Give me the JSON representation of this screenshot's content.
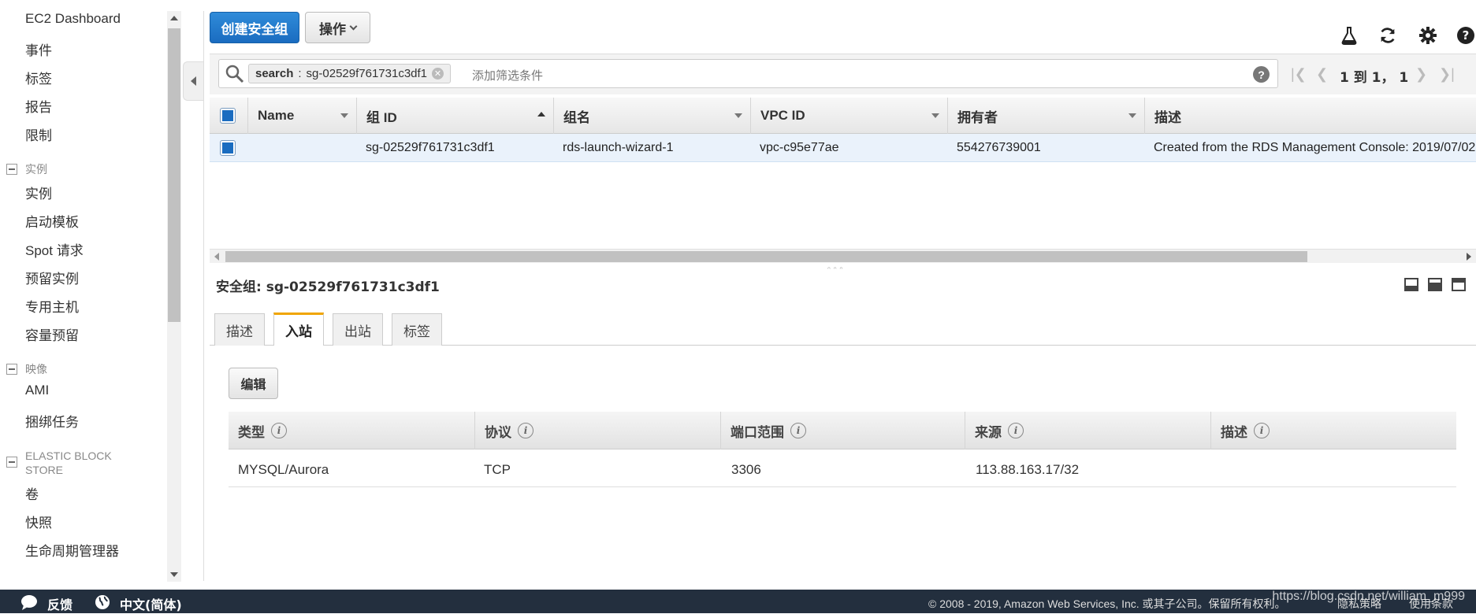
{
  "sidebar": {
    "items_top": [
      "EC2 Dashboard",
      "事件",
      "标签",
      "报告",
      "限制"
    ],
    "sections": [
      {
        "title": "实例",
        "items": [
          "实例",
          "启动模板",
          "Spot 请求",
          "预留实例",
          "专用主机",
          "容量预留"
        ]
      },
      {
        "title": "映像",
        "items": [
          "AMI",
          "捆绑任务"
        ]
      },
      {
        "title": "ELASTIC BLOCK STORE",
        "items": [
          "卷",
          "快照",
          "生命周期管理器"
        ]
      }
    ]
  },
  "toolbar": {
    "create_label": "创建安全组",
    "actions_label": "操作"
  },
  "search": {
    "token_key": "search",
    "token_value": "sg-02529f761731c3df1",
    "placeholder": "添加筛选条件",
    "help": "?"
  },
  "pager": {
    "text": "1 到 1， 1"
  },
  "grid": {
    "columns": [
      "Name",
      "组 ID",
      "组名",
      "VPC ID",
      "拥有者",
      "描述"
    ],
    "row": {
      "name": "",
      "group_id": "sg-02529f761731c3df1",
      "group_name": "rds-launch-wizard-1",
      "vpc_id": "vpc-c95e77ae",
      "owner": "554276739001",
      "description": "Created from the RDS Management Console: 2019/07/02"
    }
  },
  "detail": {
    "title": "安全组: sg-02529f761731c3df1",
    "tabs": [
      "描述",
      "入站",
      "出站",
      "标签"
    ],
    "active_tab": "入站",
    "edit_label": "编辑",
    "rules_columns": [
      "类型",
      "协议",
      "端口范围",
      "来源",
      "描述"
    ],
    "rules": [
      {
        "type": "MYSQL/Aurora",
        "protocol": "TCP",
        "port": "3306",
        "source": "113.88.163.17/32",
        "description": ""
      }
    ]
  },
  "footer": {
    "feedback": "反馈",
    "language": "中文(简体)",
    "copyright": "© 2008 - 2019, Amazon Web Services, Inc. 或其子公司。保留所有权利。",
    "privacy": "隐私策略",
    "terms": "使用条款",
    "watermark": "https://blog.csdn.net/william_m999"
  },
  "colors": {
    "primary": "#1a6cc0",
    "footer_bg": "#232f3e",
    "tab_accent": "#f0a500",
    "selected_row": "#eaf2fb"
  }
}
